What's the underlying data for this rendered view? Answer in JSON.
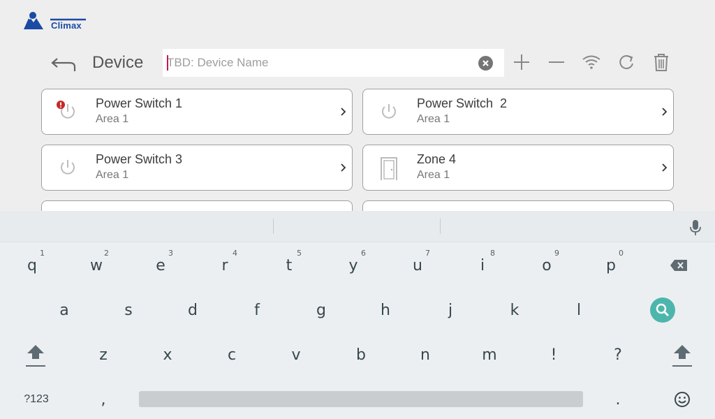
{
  "app": {
    "brand": "Climax"
  },
  "toolbar": {
    "title": "Device",
    "search_placeholder": "TBD: Device Name",
    "search_value": ""
  },
  "devices": [
    {
      "name": "Power Switch 1",
      "area": "Area 1",
      "icon": "power-icon",
      "alert": true
    },
    {
      "name": "Power Switch  2",
      "area": "Area 1",
      "icon": "power-icon",
      "alert": false
    },
    {
      "name": "Power Switch 3",
      "area": "Area 1",
      "icon": "power-icon",
      "alert": false
    },
    {
      "name": "Zone 4",
      "area": "Area 1",
      "icon": "door-icon",
      "alert": false
    }
  ],
  "keyboard": {
    "row1": [
      {
        "key": "q",
        "hint": "1"
      },
      {
        "key": "w",
        "hint": "2"
      },
      {
        "key": "e",
        "hint": "3"
      },
      {
        "key": "r",
        "hint": "4"
      },
      {
        "key": "t",
        "hint": "5"
      },
      {
        "key": "y",
        "hint": "6"
      },
      {
        "key": "u",
        "hint": "7"
      },
      {
        "key": "i",
        "hint": "8"
      },
      {
        "key": "o",
        "hint": "9"
      },
      {
        "key": "p",
        "hint": "0"
      }
    ],
    "row2": [
      "a",
      "s",
      "d",
      "f",
      "g",
      "h",
      "j",
      "k",
      "l"
    ],
    "row3": [
      "z",
      "x",
      "c",
      "v",
      "b",
      "n",
      "m",
      "!",
      "?"
    ],
    "row4": {
      "symbols": "?123",
      "comma": ",",
      "period": "."
    }
  },
  "colors": {
    "accent": "#4db6ac",
    "alert": "#c62828",
    "brand": "#1b4aa3",
    "caret": "#c2185b"
  }
}
